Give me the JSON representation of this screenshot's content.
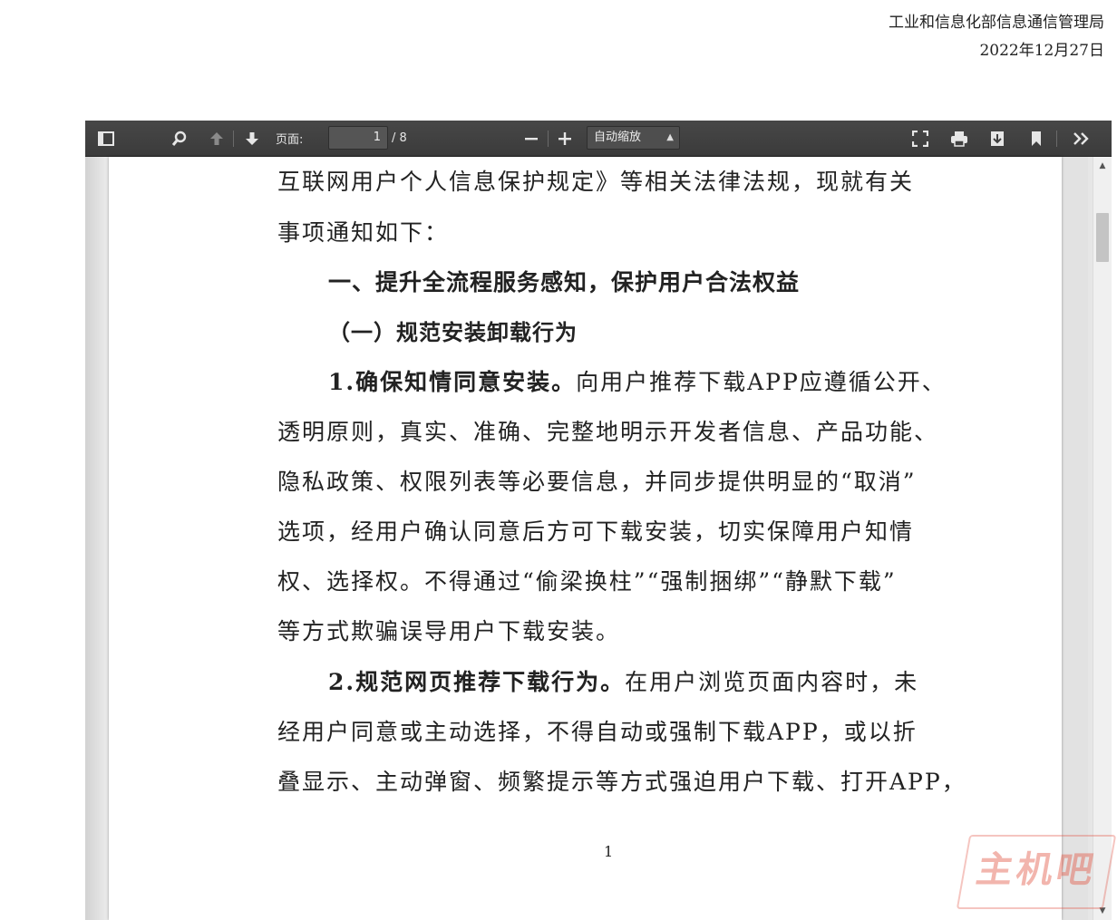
{
  "header": {
    "org": "工业和信息化部信息通信管理局",
    "date": "2022年12月27日"
  },
  "toolbar": {
    "page_label": "页面:",
    "current_page": "1",
    "total_pages": "/ 8",
    "zoom_value": "自动缩放"
  },
  "document": {
    "lines": [
      "互联网用户个人信息保护规定》等相关法律法规，现就有关",
      "事项通知如下：",
      "一、提升全流程服务感知，保护用户合法权益",
      "（一）规范安装卸载行为",
      "1.确保知情同意安装。",
      "向用户推荐下载APP应遵循公开、",
      "透明原则，真实、准确、完整地明示开发者信息、产品功能、",
      "隐私政策、权限列表等必要信息，并同步提供明显的“取消”",
      "选项，经用户确认同意后方可下载安装，切实保障用户知情",
      "权、选择权。不得通过“偷梁换柱”“强制捆绑”“静默下载”",
      "等方式欺骗误导用户下载安装。",
      "2.规范网页推荐下载行为。",
      "在用户浏览页面内容时，未",
      "经用户同意或主动选择，不得自动或强制下载APP，或以折",
      "叠显示、主动弹窗、频繁提示等方式强迫用户下载、打开APP，"
    ],
    "page_number": "1"
  },
  "watermark": {
    "text": "主机吧"
  }
}
